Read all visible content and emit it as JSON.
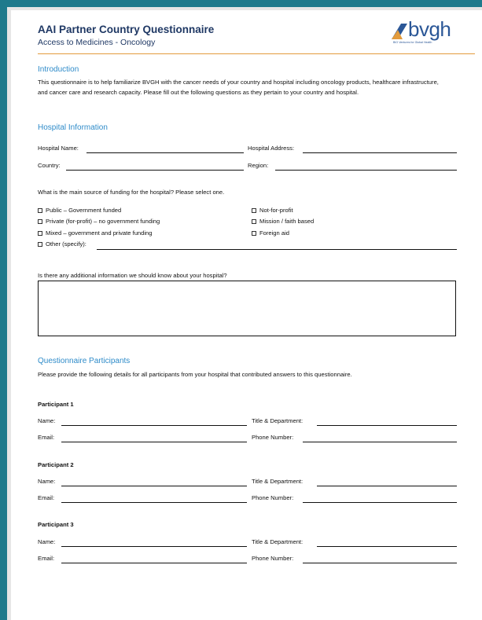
{
  "header": {
    "title": "AAI Partner Country Questionnaire",
    "subtitle": "Access to Medicines - Oncology",
    "logo_text": "bvgh",
    "logo_tagline": "BIO Ventures for Global Health",
    "accent_color": "#1f7a8c",
    "rule_color": "#e39b3c"
  },
  "introduction": {
    "heading": "Introduction",
    "text": "This questionnaire is to help familiarize BVGH with the cancer needs of your country and hospital including oncology products, healthcare infrastructure, and cancer care and research capacity. Please fill out the following questions as they pertain to your country and hospital."
  },
  "hospital": {
    "heading": "Hospital Information",
    "name_label": "Hospital Name:",
    "address_label": "Hospital Address:",
    "country_label": "Country:",
    "region_label": "Region:",
    "funding_question": "What is the main source of funding for the hospital? Please select one.",
    "options_left": [
      "Public – Government funded",
      "Private (for-profit) – no government funding",
      "Mixed – government and private funding",
      "Other (specify):"
    ],
    "options_right": [
      "Not-for-profit",
      "Mission / faith based",
      "Foreign aid"
    ],
    "additional_question": "Is there any additional information we should know about your hospital?"
  },
  "participants": {
    "heading": "Questionnaire Participants",
    "intro": "Please provide the following details for all participants from your hospital that contributed answers to this questionnaire.",
    "name_label": "Name:",
    "email_label": "Email:",
    "title_label": "Title & Department:",
    "phone_label": "Phone Number:",
    "items": [
      {
        "heading": "Participant 1"
      },
      {
        "heading": "Participant 2"
      },
      {
        "heading": "Participant 3"
      }
    ]
  }
}
